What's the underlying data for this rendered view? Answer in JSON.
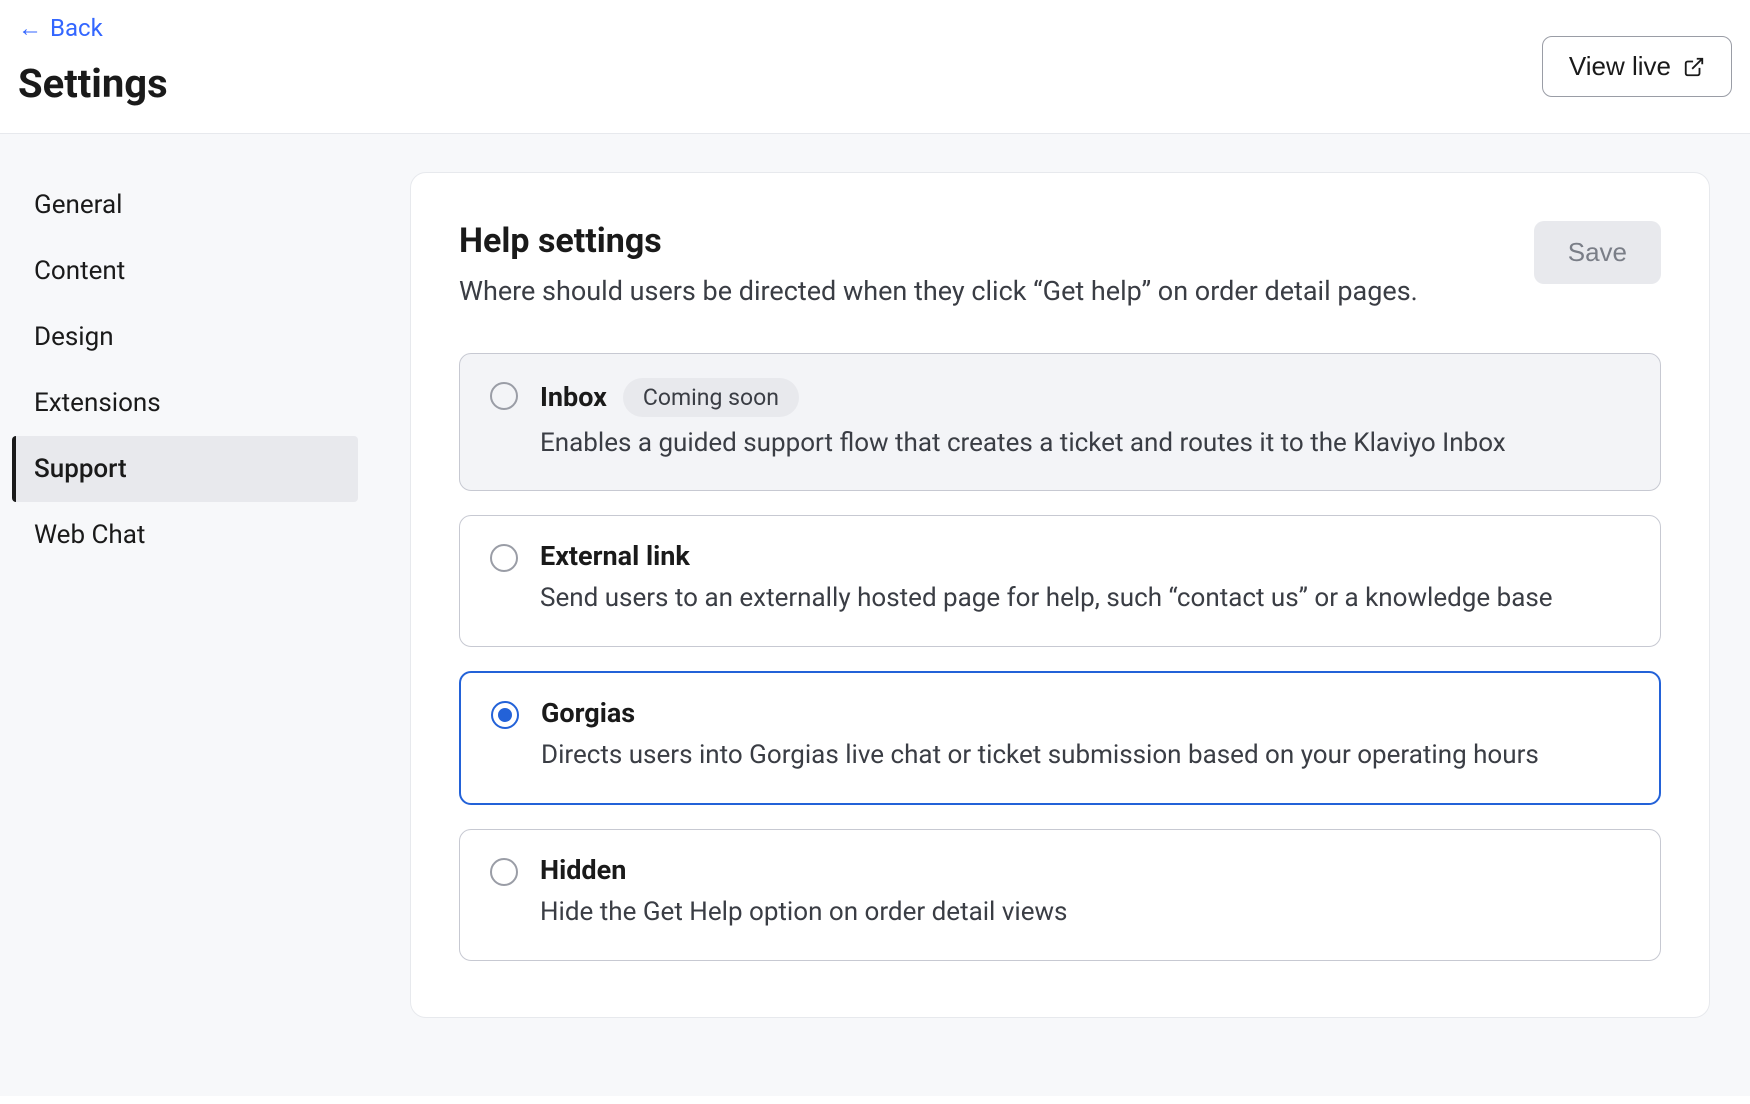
{
  "header": {
    "back_label": "Back",
    "page_title": "Settings",
    "view_live_label": "View live"
  },
  "sidebar": {
    "items": [
      {
        "label": "General",
        "active": false
      },
      {
        "label": "Content",
        "active": false
      },
      {
        "label": "Design",
        "active": false
      },
      {
        "label": "Extensions",
        "active": false
      },
      {
        "label": "Support",
        "active": true
      },
      {
        "label": "Web Chat",
        "active": false
      }
    ]
  },
  "main": {
    "title": "Help settings",
    "subtitle": "Where should users be directed when they click “Get help” on order detail pages.",
    "save_label": "Save",
    "options": [
      {
        "title": "Inbox",
        "badge": "Coming soon",
        "description": "Enables a guided support flow that creates a ticket and routes it to the Klaviyo Inbox",
        "disabled": true,
        "selected": false
      },
      {
        "title": "External link",
        "badge": "",
        "description": "Send users to an externally hosted page for help, such “contact us” or a knowledge base",
        "disabled": false,
        "selected": false
      },
      {
        "title": "Gorgias",
        "badge": "",
        "description": "Directs users into Gorgias live chat or ticket submission based on your operating hours",
        "disabled": false,
        "selected": true
      },
      {
        "title": "Hidden",
        "badge": "",
        "description": "Hide the Get Help option on order detail views",
        "disabled": false,
        "selected": false
      }
    ]
  }
}
